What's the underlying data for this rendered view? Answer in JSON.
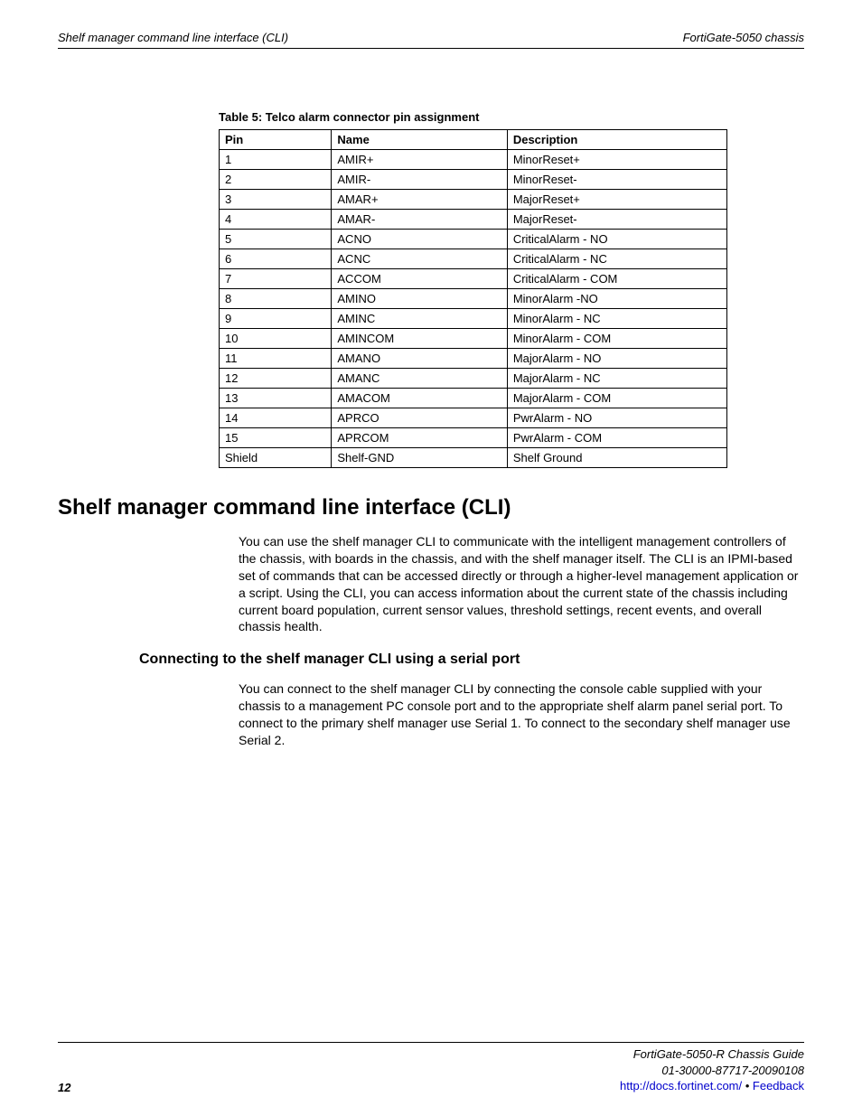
{
  "header": {
    "left": "Shelf manager command line interface (CLI)",
    "right": "FortiGate-5050 chassis"
  },
  "table": {
    "caption": "Table 5: Telco alarm connector pin assignment",
    "headers": {
      "pin": "Pin",
      "name": "Name",
      "desc": "Description"
    },
    "rows": [
      {
        "pin": "1",
        "name": "AMIR+",
        "desc": "MinorReset+"
      },
      {
        "pin": "2",
        "name": "AMIR-",
        "desc": "MinorReset-"
      },
      {
        "pin": "3",
        "name": "AMAR+",
        "desc": "MajorReset+"
      },
      {
        "pin": "4",
        "name": "AMAR-",
        "desc": "MajorReset-"
      },
      {
        "pin": "5",
        "name": "ACNO",
        "desc": "CriticalAlarm - NO"
      },
      {
        "pin": "6",
        "name": "ACNC",
        "desc": "CriticalAlarm - NC"
      },
      {
        "pin": "7",
        "name": "ACCOM",
        "desc": "CriticalAlarm - COM"
      },
      {
        "pin": "8",
        "name": "AMINO",
        "desc": "MinorAlarm -NO"
      },
      {
        "pin": "9",
        "name": "AMINC",
        "desc": "MinorAlarm - NC"
      },
      {
        "pin": "10",
        "name": "AMINCOM",
        "desc": "MinorAlarm - COM"
      },
      {
        "pin": "11",
        "name": "AMANO",
        "desc": "MajorAlarm - NO"
      },
      {
        "pin": "12",
        "name": "AMANC",
        "desc": "MajorAlarm - NC"
      },
      {
        "pin": "13",
        "name": "AMACOM",
        "desc": "MajorAlarm - COM"
      },
      {
        "pin": "14",
        "name": "APRCO",
        "desc": "PwrAlarm - NO"
      },
      {
        "pin": "15",
        "name": "APRCOM",
        "desc": "PwrAlarm - COM"
      },
      {
        "pin": "Shield",
        "name": "Shelf-GND",
        "desc": "Shelf Ground"
      }
    ]
  },
  "section": {
    "heading": "Shelf manager command line interface (CLI)",
    "para1": "You can use the shelf manager CLI to communicate with the intelligent management controllers of the chassis, with boards in the chassis, and with the shelf manager itself. The CLI is an IPMI-based set of commands that can be accessed directly or through a higher-level management application or a script. Using the CLI, you can access information about the current state of the chassis including current board population, current sensor values, threshold settings, recent events, and overall chassis health.",
    "subheading": "Connecting to the shelf manager CLI using a serial port",
    "para2": "You can connect to the shelf manager CLI by connecting the console cable supplied with your chassis to a management PC console port and to the appropriate shelf alarm panel serial port. To connect to the primary shelf manager use Serial 1. To connect to the secondary shelf manager use Serial 2."
  },
  "footer": {
    "page": "12",
    "line1": "FortiGate-5050-R   Chassis Guide",
    "line2": "01-30000-87717-20090108",
    "link": "http://docs.fortinet.com/",
    "sep": " • ",
    "feedback": "Feedback"
  }
}
